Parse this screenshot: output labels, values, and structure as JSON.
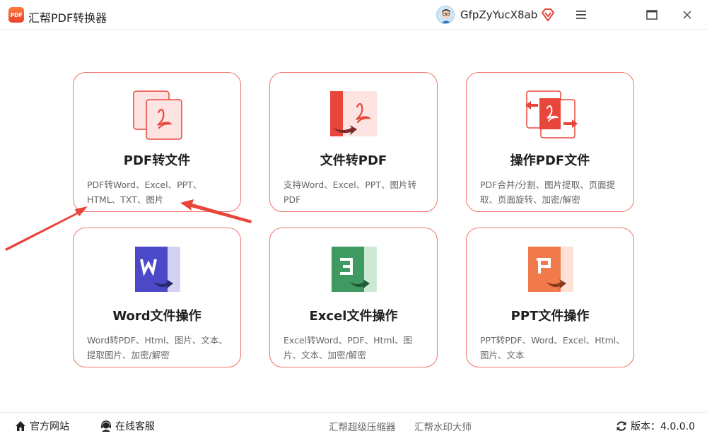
{
  "app": {
    "logo_text": "PDF",
    "title": "汇帮PDF转换器"
  },
  "user": {
    "name": "GfpZyYucX8ab"
  },
  "icons": {
    "logo": "app-logo-icon",
    "avatar": "avatar-icon",
    "vip": "diamond-vip-icon",
    "menu": "hamburger-menu-icon",
    "maximize": "maximize-icon",
    "close": "close-icon",
    "home": "home-icon",
    "support": "headset-icon",
    "refresh": "refresh-icon"
  },
  "colors": {
    "accent": "#e8463a",
    "card_border": "#f0756a",
    "word": "#4b49c8",
    "excel": "#3f9a62",
    "ppt": "#f07a4b"
  },
  "cards": [
    {
      "title": "PDF转文件",
      "desc": "PDF转Word、Excel、PPT、HTML、TXT、图片",
      "icon": "pdf-to-file-icon"
    },
    {
      "title": "文件转PDF",
      "desc": "支持Word、Excel、PPT、图片转PDF",
      "icon": "file-to-pdf-icon"
    },
    {
      "title": "操作PDF文件",
      "desc": "PDF合并/分割、图片提取、页面提取、页面旋转、加密/解密",
      "icon": "pdf-operations-icon"
    },
    {
      "title": "Word文件操作",
      "desc": "Word转PDF、Html、图片、文本、提取图片、加密/解密",
      "icon": "word-file-icon"
    },
    {
      "title": "Excel文件操作",
      "desc": "Excel转Word、PDF、Html、图片、文本、加密/解密",
      "icon": "excel-file-icon"
    },
    {
      "title": "PPT文件操作",
      "desc": "PPT转PDF、Word、Excel、Html、图片、文本",
      "icon": "ppt-file-icon"
    }
  ],
  "footer": {
    "website": "官方网站",
    "support": "在线客服",
    "compressor": "汇帮超级压缩器",
    "watermark": "汇帮水印大师",
    "version": "版本：4.0.0.0"
  }
}
